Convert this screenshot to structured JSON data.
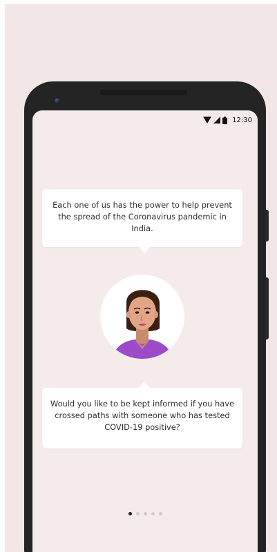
{
  "status_bar": {
    "time": "12:30",
    "icons": [
      "wifi-icon",
      "signal-icon",
      "battery-icon"
    ]
  },
  "onboarding": {
    "top_message": "Each one of us has the power to help prevent the spread of the Coronavirus pandemic in India.",
    "bottom_message": "Would you like to be kept informed if you have crossed paths with someone who has tested COVID-19 positive?",
    "avatar_icon": "woman-avatar-icon"
  },
  "pagination": {
    "total": 5,
    "active_index": 0
  },
  "colors": {
    "page_background": "#f2e6e6",
    "screen_background": "#f5ebeb",
    "phone_body": "#242424",
    "bubble": "#ffffff",
    "text": "#2e2e2e",
    "accent_purple": "#9b4bc8",
    "active_dot": "#222222",
    "inactive_dot": "#d5cbcb"
  }
}
